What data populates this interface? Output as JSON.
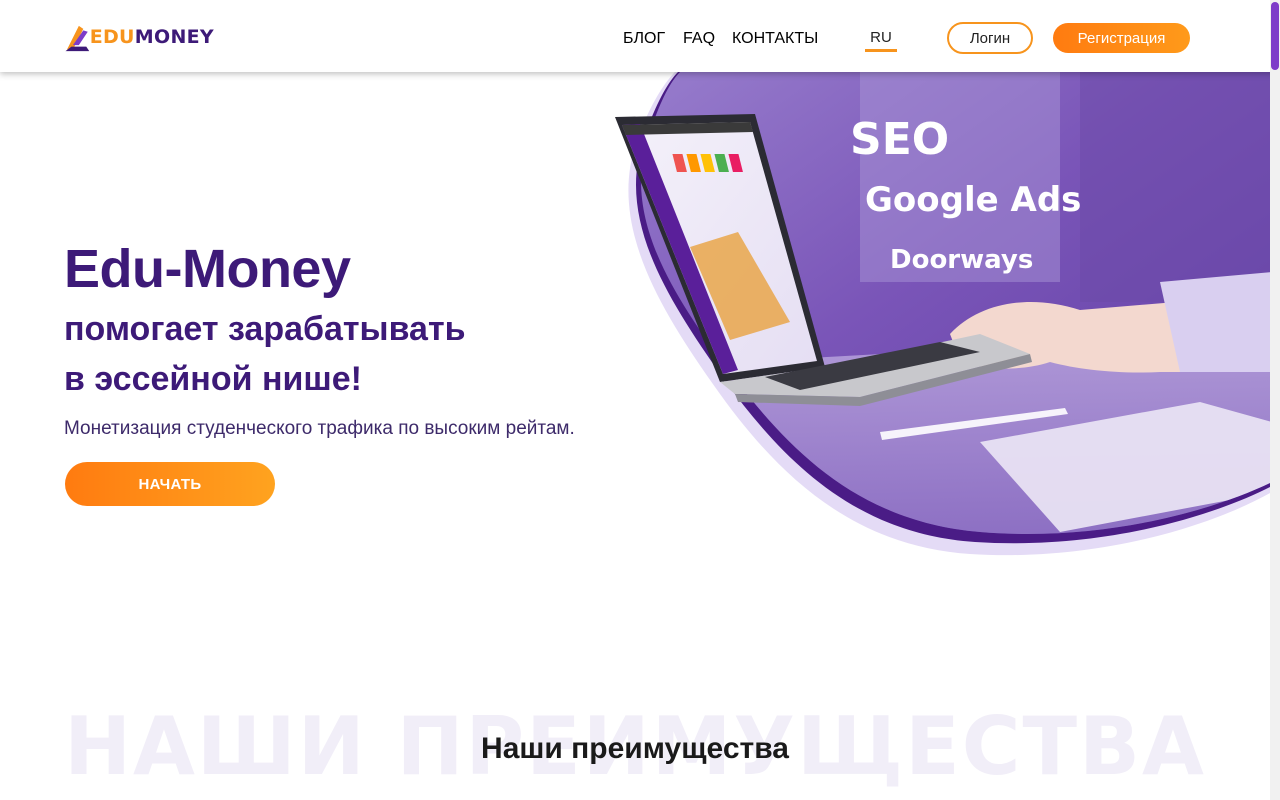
{
  "header": {
    "logo_edu": "EDU",
    "logo_money": "MONEY",
    "nav": [
      {
        "label": "БЛОГ"
      },
      {
        "label": "FAQ"
      },
      {
        "label": "КОНТАКТЫ"
      }
    ],
    "lang": "RU",
    "login_label": "Логин",
    "register_label": "Регистрация"
  },
  "hero": {
    "title": "Edu-Money",
    "subtitle_line1": "помогает зарабатывать",
    "subtitle_line2": "в эссейной нише!",
    "description": "Монетизация студенческого трафика по высоким рейтам.",
    "start_label": "НАЧАТЬ",
    "words": [
      "SEO",
      "Google Ads",
      "Doorways"
    ]
  },
  "advantages": {
    "bg_word": "НАШИ ПРЕИМУЩЕСТВА",
    "title": "Наши преимущества"
  },
  "colors": {
    "brand_purple": "#3d1a78",
    "accent_orange": "#f7941d",
    "hero_violet": "#7a55b8"
  }
}
